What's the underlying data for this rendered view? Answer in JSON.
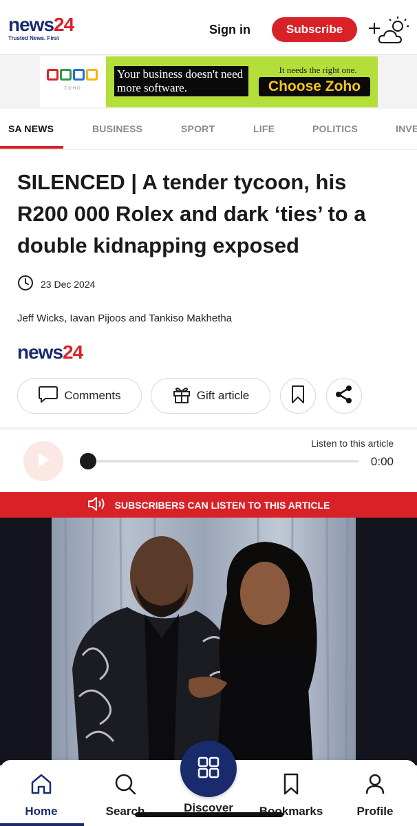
{
  "header": {
    "logo_news": "news",
    "logo_num": "24",
    "logo_tagline": "Trusted News. First",
    "sign_in": "Sign in",
    "subscribe": "Subscribe"
  },
  "ad": {
    "brand_caption": "ZOHO",
    "headline": "Your business doesn't need more software.",
    "subline": "It needs the right one.",
    "cta": "Choose Zoho"
  },
  "nav": {
    "tabs": [
      "SA NEWS",
      "BUSINESS",
      "SPORT",
      "LIFE",
      "POLITICS",
      "INVE"
    ]
  },
  "article": {
    "headline": "SILENCED | A tender tycoon, his R200 000 Rolex and dark ‘ties’ to a double kidnapping exposed",
    "date": "23 Dec 2024",
    "authors": "Jeff Wicks, Iavan Pijoos and Tankiso Makhetha",
    "source_news": "news",
    "source_num": "24"
  },
  "actions": {
    "comments": "Comments",
    "gift": "Gift article"
  },
  "audio": {
    "listen_label": "Listen to this article",
    "time": "0:00",
    "progress": 0
  },
  "banner": {
    "text": "SUBSCRIBERS CAN LISTEN TO THIS ARTICLE"
  },
  "bottom_nav": {
    "items": [
      "Home",
      "Search",
      "Discover",
      "Bookmarks",
      "Profile"
    ]
  },
  "colors": {
    "brand_red": "#d92228",
    "brand_navy": "#1a2b6d",
    "ad_green": "#b4df3a"
  }
}
